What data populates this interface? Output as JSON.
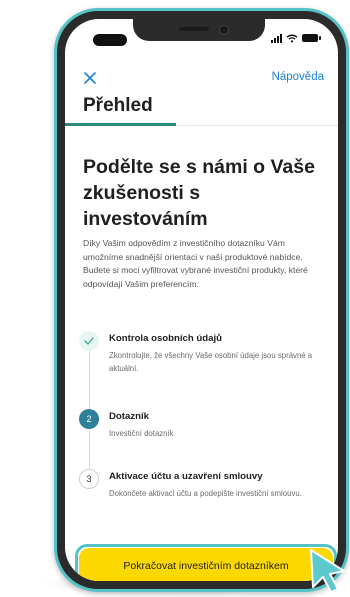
{
  "nav": {
    "close_label": "×",
    "help_label": "Nápověda"
  },
  "page": {
    "title": "Přehled",
    "heading": "Podělte se s námi o Vaše zkušenosti s investováním",
    "intro": "Díky Vašim odpovědím z investičního dotazníku Vám umožníme snadnější orientaci v naší produktové nabídce. Budete si moci vyfiltrovat vybrané investiční produkty, které odpovídají Vašim preferencím."
  },
  "steps": [
    {
      "state": "done",
      "marker": "✓",
      "title": "Kontrola osobních údajů",
      "desc": "Zkontrolujte, že všechny Vaše osobní údaje jsou správné a aktuální."
    },
    {
      "state": "active",
      "marker": "2",
      "title": "Dotazník",
      "desc": "Investiční dotazník"
    },
    {
      "state": "todo",
      "marker": "3",
      "title": "Aktivace účtu a uzavření smlouvy",
      "desc": "Dokončete aktivaci účtu a podepište investiční smlouvu."
    }
  ],
  "cta": {
    "label": "Pokračovat investičním dotazníkem"
  },
  "colors": {
    "accent": "#54c2c6",
    "link": "#1d7fd6",
    "primary_button": "#fbd900",
    "active_step": "#2e7f9a"
  },
  "icons": {
    "close": "close-icon",
    "signal": "signal-icon",
    "wifi": "wifi-icon",
    "battery": "battery-icon",
    "check": "check-icon",
    "cursor": "pointer-cursor-icon"
  }
}
